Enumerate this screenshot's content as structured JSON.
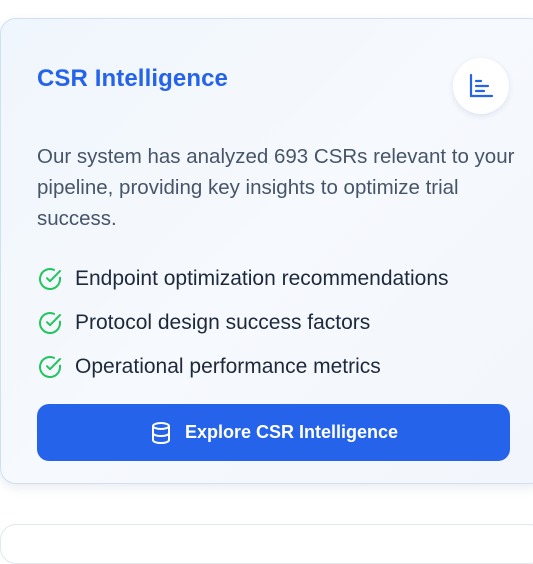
{
  "card": {
    "title": "CSR Intelligence",
    "icon": "bar-chart-icon",
    "description": "Our system has analyzed 693 CSRs relevant to your pipeline, providing key insights to optimize trial success.",
    "features": [
      {
        "icon": "check-circle-icon",
        "label": "Endpoint optimization recommendations"
      },
      {
        "icon": "check-circle-icon",
        "label": "Protocol design success factors"
      },
      {
        "icon": "check-circle-icon",
        "label": "Operational performance metrics"
      }
    ],
    "cta": {
      "icon": "database-icon",
      "label": "Explore CSR Intelligence"
    }
  },
  "colors": {
    "accent": "#2563eb",
    "check": "#22c55e",
    "text": "#1e293b",
    "muted": "#475569"
  }
}
